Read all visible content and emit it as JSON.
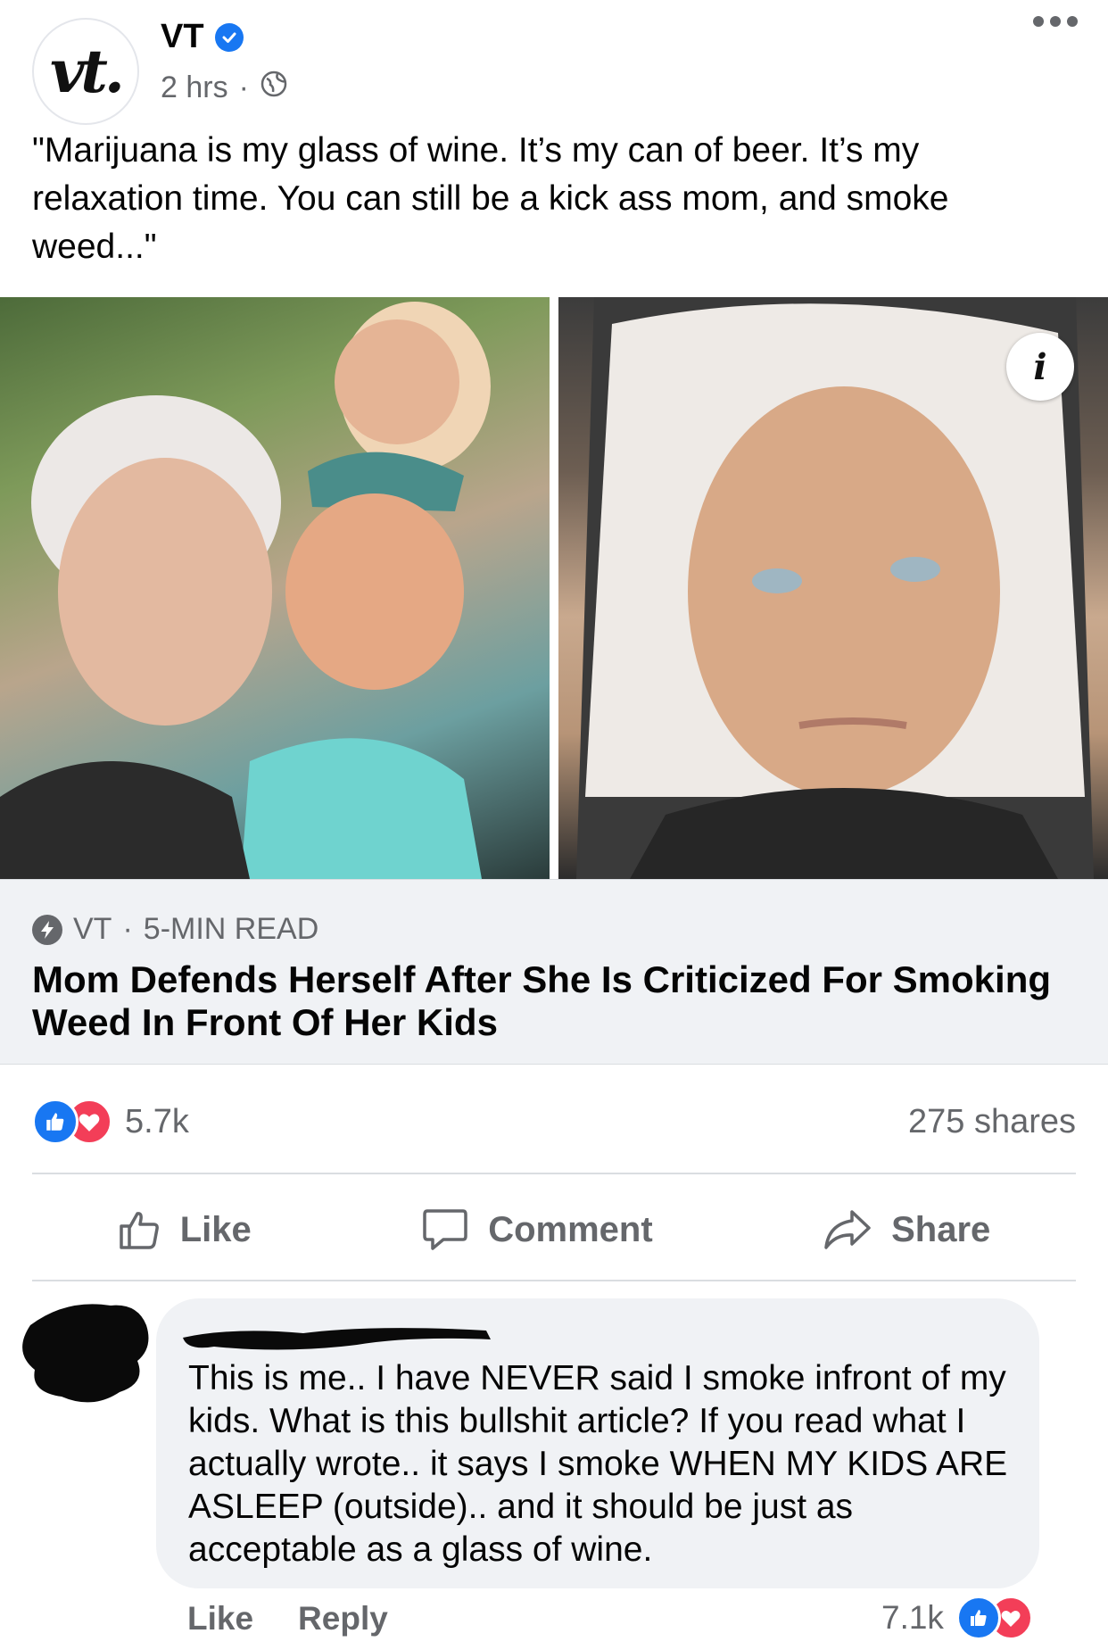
{
  "post": {
    "page_name": "VT",
    "avatar_text": "vt.",
    "time": "2 hrs",
    "separator": "·",
    "caption": "\"Marijuana is my glass of wine. It’s my can of beer. It’s my relaxation time. You can still be a kick ass mom, and smoke weed...\""
  },
  "link_preview": {
    "source": "VT",
    "read_time": "5-MIN READ",
    "separator": "·",
    "headline": "Mom Defends Herself After She Is Criticized For Smoking Weed In Front Of Her Kids",
    "info_glyph": "i"
  },
  "stats": {
    "reaction_count": "5.7k",
    "shares": "275 shares"
  },
  "actions": {
    "like": "Like",
    "comment": "Comment",
    "share": "Share"
  },
  "comment": {
    "text": "This is me.. I have NEVER said I smoke infront of my kids. What is this bullshit article? If you read what I actually wrote.. it says I smoke WHEN MY KIDS ARE ASLEEP (outside).. and it should be just as acceptable as a glass of wine.",
    "like": "Like",
    "reply": "Reply",
    "reaction_count": "7.1k"
  },
  "icons": [
    "verified-icon",
    "globe-icon",
    "more-icon",
    "info-icon",
    "bolt-icon",
    "like-reaction-icon",
    "love-reaction-icon",
    "like-thumb-icon",
    "comment-bubble-icon",
    "share-arrow-icon"
  ],
  "colors": {
    "brand_blue": "#1877f2",
    "love_red": "#f33e58",
    "meta_gray": "#65676b",
    "preview_bg": "#f0f2f5"
  }
}
